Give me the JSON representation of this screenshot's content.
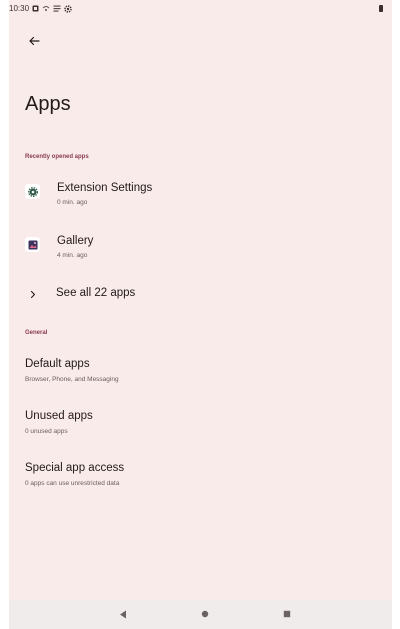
{
  "status_bar": {
    "time": "10:30",
    "icons": [
      "notification-icon",
      "wifi-calling-icon",
      "sim-icon",
      "settings-gear-icon",
      "battery-icon"
    ]
  },
  "header": {
    "back_icon": "arrow-back-icon",
    "title": "Apps"
  },
  "recent": {
    "section_label": "Recently opened apps",
    "apps": [
      {
        "name": "Extension Settings",
        "subtitle": "0 min. ago",
        "icon": "extension-settings-icon"
      },
      {
        "name": "Gallery",
        "subtitle": "4 min. ago",
        "icon": "gallery-icon"
      }
    ],
    "see_all_label": "See all 22 apps",
    "see_all_icon": "chevron-right-icon"
  },
  "general": {
    "section_label": "General",
    "items": [
      {
        "title": "Default apps",
        "subtitle": "Browser, Phone, and Messaging"
      },
      {
        "title": "Unused apps",
        "subtitle": "0 unused apps"
      },
      {
        "title": "Special app access",
        "subtitle": "0 apps can use unrestricted data"
      }
    ]
  },
  "nav_bar": {
    "buttons": [
      "back-triangle-icon",
      "home-circle-icon",
      "recents-square-icon"
    ]
  },
  "colors": {
    "background": "#f8ebea",
    "accent": "#8a3b50",
    "text": "#231919"
  }
}
